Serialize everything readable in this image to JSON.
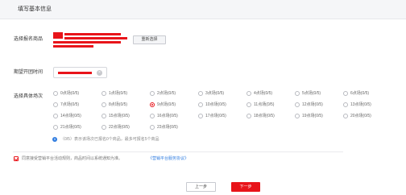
{
  "header": {
    "title": "填写基本信息"
  },
  "form": {
    "product_label": "选择报名商品",
    "reselect_label": "重新选择",
    "time_label": "期望开团时间",
    "clear_icon": "clear-icon",
    "slot_label": "选择具体场次"
  },
  "slots": [
    {
      "text": "0点场(0/5)",
      "checked": false
    },
    {
      "text": "1点场(0/5)",
      "checked": false
    },
    {
      "text": "2点场(0/5)",
      "checked": false
    },
    {
      "text": "3点场(0/5)",
      "checked": false
    },
    {
      "text": "4点场(0/5)",
      "checked": false
    },
    {
      "text": "5点场(0/5)",
      "checked": false
    },
    {
      "text": "6点场(0/5)",
      "checked": false
    },
    {
      "text": "7点场(0/5)",
      "checked": false
    },
    {
      "text": "8点场(0/5)",
      "checked": false
    },
    {
      "text": "9点场(0/5)",
      "checked": true
    },
    {
      "text": "10点场(0/5)",
      "checked": false
    },
    {
      "text": "11点场(0/5)",
      "checked": false
    },
    {
      "text": "12点场(0/5)",
      "checked": false
    },
    {
      "text": "13点场(0/5)",
      "checked": false
    },
    {
      "text": "14点场(0/5)",
      "checked": false
    },
    {
      "text": "15点场(0/5)",
      "checked": false
    },
    {
      "text": "16点场(0/5)",
      "checked": false
    },
    {
      "text": "17点场(0/5)",
      "checked": false
    },
    {
      "text": "18点场(0/5)",
      "checked": false
    },
    {
      "text": "19点场(0/5)",
      "checked": false
    },
    {
      "text": "20点场(0/5)",
      "checked": false
    },
    {
      "text": "21点场(0/5)",
      "checked": false
    },
    {
      "text": "22点场(0/5)",
      "checked": false
    },
    {
      "text": "23点场(0/5)",
      "checked": false
    }
  ],
  "hint": {
    "icon": "info-icon",
    "text": "（0/5）表示该场次已报名0个商品，最多可报名5个商品"
  },
  "agreement": {
    "checked": true,
    "text": "同意接受营销平台活动规则，商品时间以系统通知为准。",
    "link": "《营销平台服务协议》"
  },
  "buttons": {
    "prev": "上一步",
    "next": "下一步"
  },
  "colors": {
    "accent": "#e8141a",
    "link": "#2f7ce0"
  }
}
